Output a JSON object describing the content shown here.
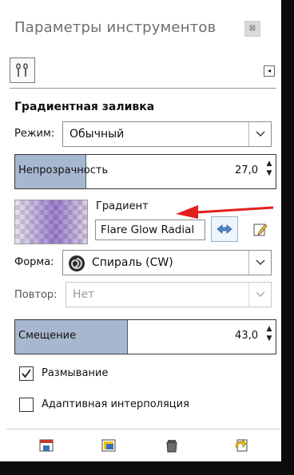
{
  "panel": {
    "title": "Параметры инструментов",
    "close_glyph": "⊠",
    "menu_glyph": "◂"
  },
  "tool": {
    "name": "Градиентная заливка",
    "mode_label": "Режим:",
    "mode_value": "Обычный",
    "opacity_label": "Непрозрачность",
    "opacity_value": "27,0",
    "opacity_fraction": 0.27,
    "gradient_label": "Градиент",
    "gradient_name": "Flare Glow Radial",
    "shape_label": "Форма:",
    "shape_value": "Спираль (CW)",
    "repeat_label": "Повтор:",
    "repeat_value": "Нет",
    "offset_label": "Смещение",
    "offset_value": "43,0",
    "offset_fraction": 0.43,
    "dither_label": "Размывание",
    "dither_checked": true,
    "adaptive_label": "Адаптивная интерполяция",
    "adaptive_checked": false
  },
  "icons": {
    "tab": "tool-options-tab-icon",
    "swap": "swap-arrows-icon",
    "edit": "edit-gradient-icon",
    "save": "save-options-icon",
    "restore": "restore-options-icon",
    "delete": "delete-options-icon",
    "reset": "reset-options-icon"
  },
  "colors": {
    "slider_fill": "#a7b7cf",
    "annotation_arrow": "#e0201c"
  }
}
